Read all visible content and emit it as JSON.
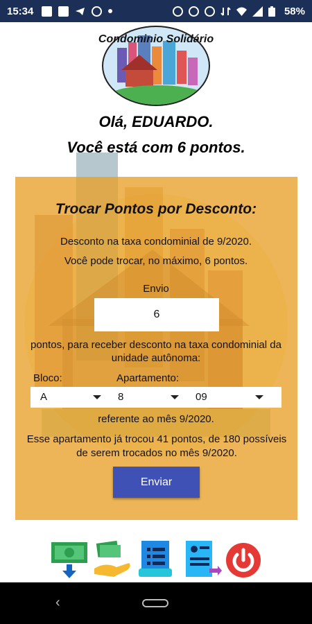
{
  "status_bar": {
    "time": "15:34",
    "battery": "58%",
    "left_icons": [
      "image-icon",
      "news-icon",
      "telegram-icon",
      "whatsapp-icon",
      "dot-icon"
    ],
    "right_icons": [
      "alarm-icon",
      "vibrate-icon",
      "dnd-icon",
      "data-icon",
      "wifi-icon",
      "signal-icon",
      "battery-icon"
    ]
  },
  "header": {
    "app_title": "Condominio Solidário",
    "greeting": "Olá, EDUARDO.",
    "points_text": "Você está com 6 pontos."
  },
  "panel": {
    "title": "Trocar Pontos por Desconto:",
    "discount_line": "Desconto na taxa condominial de 9/2020.",
    "max_line": "Você pode trocar, no máximo, 6 pontos.",
    "envio_label": "Envio",
    "points_value": "6",
    "description": "pontos, para receber desconto na taxa condominial da unidade autônoma:",
    "bloco_label": "Bloco:",
    "apartamento_label": "Apartamento:",
    "bloco_value": "A",
    "apartamento_value": "8",
    "unit_value": "09",
    "reference": "referente ao mês 9/2020.",
    "info": "Esse apartamento já trocou 41 pontos, de 180 possíveis de serem trocados no mês 9/2020.",
    "send_label": "Enviar"
  },
  "bottom_icons": [
    "money-download-icon",
    "hand-money-icon",
    "list-icon",
    "document-export-icon",
    "power-icon"
  ],
  "colors": {
    "status_bar": "#1c2f56",
    "panel": "#e8a028",
    "button": "#3f51b5",
    "power": "#e53935"
  }
}
